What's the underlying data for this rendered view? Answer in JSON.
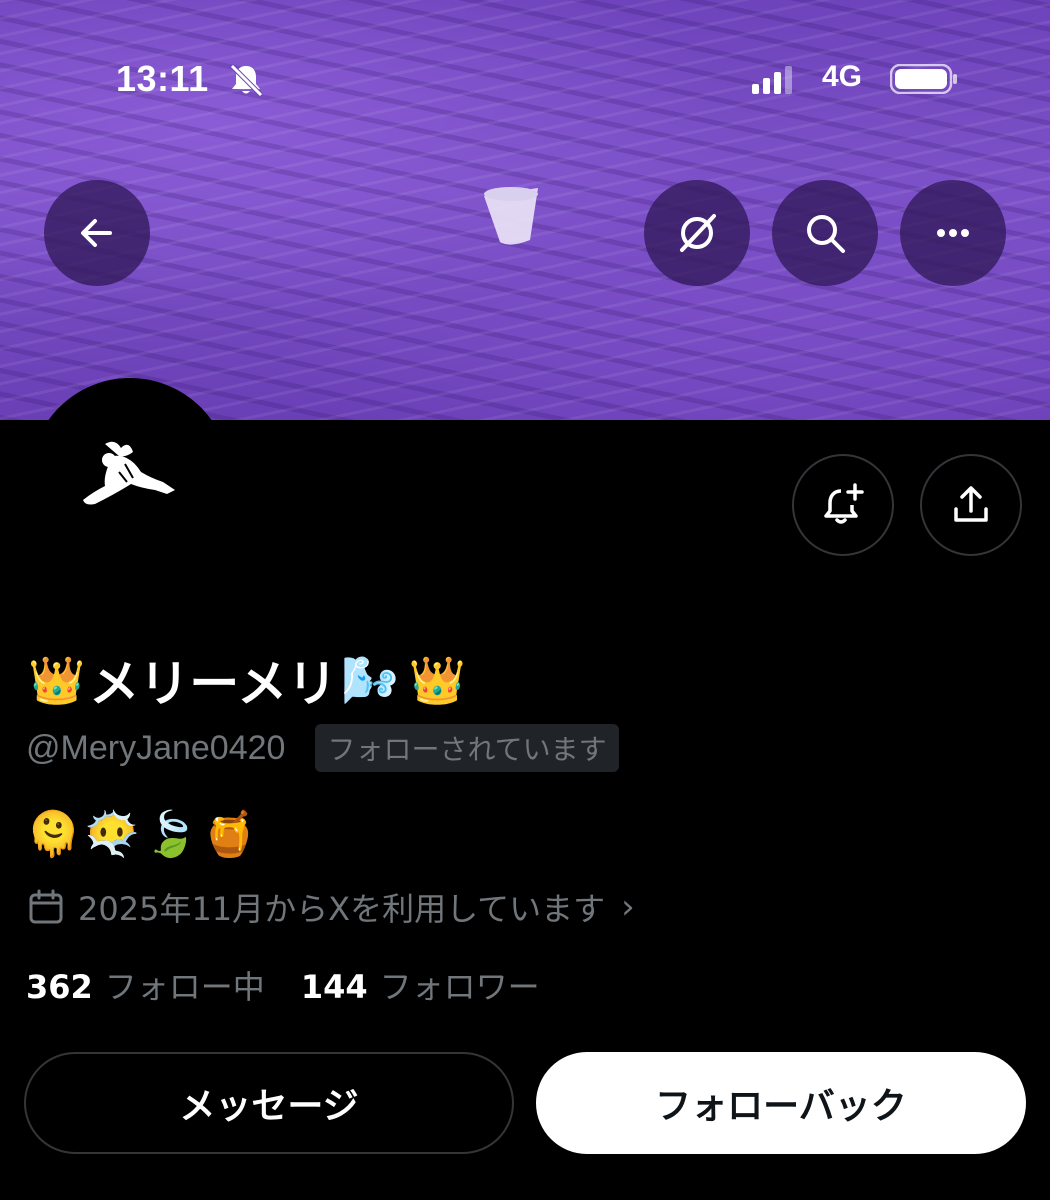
{
  "status_bar": {
    "time": "13:11",
    "network": "4G",
    "icons": [
      "bell-slash-icon",
      "cellular-signal-icon",
      "battery-icon"
    ]
  },
  "header": {
    "buttons": [
      "back-arrow-icon",
      "grok-icon",
      "search-icon",
      "more-icon"
    ]
  },
  "profile": {
    "name_prefix_emoji": "👑",
    "name": "メリーメリ",
    "name_suffix_emoji": "🌬️",
    "name_end_emoji": "👑",
    "handle": "@MeryJane0420",
    "follows_you": "フォローされています",
    "bio": "🫠😶‍🌫️🍃🍯",
    "joined": "2025年11月からXを利用しています",
    "following_count": "362",
    "following_label": "フォロー中",
    "followers_count": "144",
    "followers_label": "フォロワー"
  },
  "actions": {
    "message": "メッセージ",
    "follow_back": "フォローバック",
    "icons": [
      "bell-plus-icon",
      "share-icon"
    ]
  },
  "colors": {
    "banner": "#7d52c8",
    "background": "#000000",
    "secondary_text": "#71767b",
    "follow_button": "#ffffff"
  }
}
